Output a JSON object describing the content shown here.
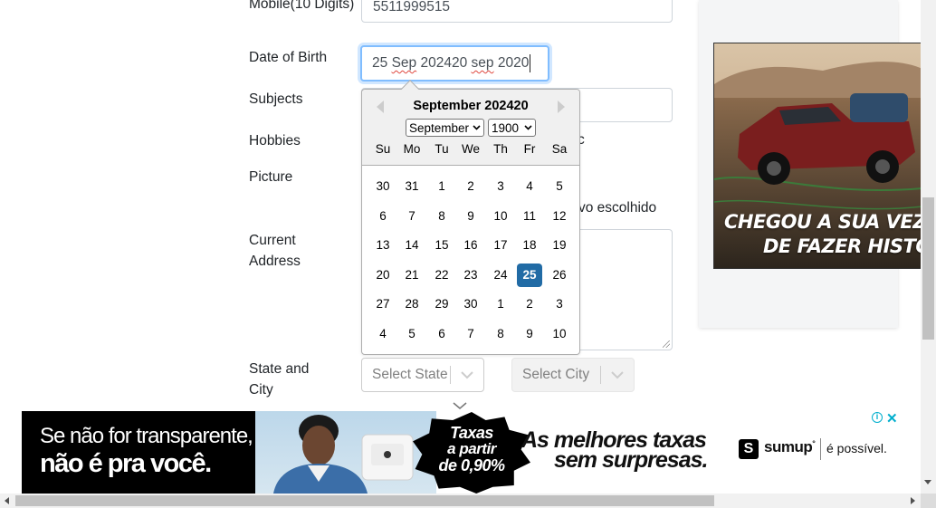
{
  "form": {
    "mobile_label": "Mobile(10 Digits)",
    "mobile_value": "5511999515",
    "dob_label": "Date of Birth",
    "dob_value_part1": "25",
    "dob_value_part2": "Sep",
    "dob_value_part3": "202420",
    "dob_value_part4": "sep",
    "dob_value_part5": "2020",
    "subjects_label": "Subjects",
    "hobbies_label": "Hobbies",
    "hobbies_partial": "c",
    "picture_label": "Picture",
    "picture_partial": "vo escolhido",
    "address_label_line1": "Current",
    "address_label_line2": "Address",
    "state_city_label_line1": "State and",
    "state_city_label_line2": "City",
    "state_placeholder": "Select State",
    "city_placeholder": "Select City"
  },
  "datepicker": {
    "title": "September 202420",
    "month_select": "September",
    "year_select": "1900",
    "weekdays": [
      "Su",
      "Mo",
      "Tu",
      "We",
      "Th",
      "Fr",
      "Sa"
    ],
    "weeks": [
      [
        "30",
        "31",
        "1",
        "2",
        "3",
        "4",
        "5"
      ],
      [
        "6",
        "7",
        "8",
        "9",
        "10",
        "11",
        "12"
      ],
      [
        "13",
        "14",
        "15",
        "16",
        "17",
        "18",
        "19"
      ],
      [
        "20",
        "21",
        "22",
        "23",
        "24",
        "25",
        "26"
      ],
      [
        "27",
        "28",
        "29",
        "30",
        "1",
        "2",
        "3"
      ],
      [
        "4",
        "5",
        "6",
        "7",
        "8",
        "9",
        "10"
      ]
    ],
    "selected_day": "25",
    "selected_color": "#216ba5"
  },
  "side_ad": {
    "headline_line1": "CHEGOU A SUA VEZ",
    "headline_line2": "DE FAZER HISTÓRIA"
  },
  "bottom_ad": {
    "left_line1": "Se não for transparente,",
    "left_line2": "não é pra você.",
    "badge_line1": "Taxas",
    "badge_line2": "a partir",
    "badge_line3": "de 0,90%",
    "main_line1": "As melhores taxas",
    "main_line2": "sem surpresas.",
    "brand": "sumup",
    "brand_sup": "°",
    "tagline": "é possível."
  },
  "colors": {
    "focus_border": "#80bdff",
    "ad_accent": "#00aecd"
  }
}
